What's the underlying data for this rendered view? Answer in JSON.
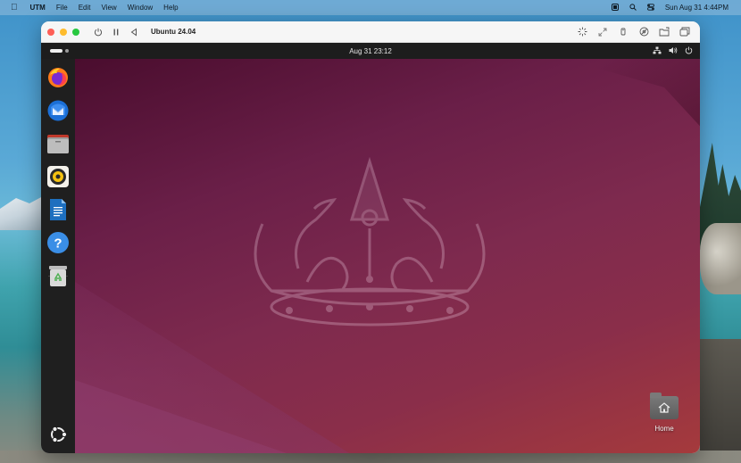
{
  "menubar": {
    "app_name": "UTM",
    "items": [
      "File",
      "Edit",
      "View",
      "Window",
      "Help"
    ],
    "datetime": "Sun Aug 31  4:44PM",
    "status_icons": [
      "screen-icon",
      "search-icon",
      "control-center-icon"
    ]
  },
  "window": {
    "title": "Ubuntu 24.04",
    "left_controls": [
      "power-icon",
      "pause-icon",
      "back-icon"
    ],
    "right_controls": [
      "display-icon",
      "resize-icon",
      "usb-icon",
      "drive-icon",
      "shared-folder-icon",
      "windows-icon"
    ]
  },
  "ubuntu": {
    "topbar": {
      "clock": "Aug 31  23:12",
      "tray_icons": [
        "network-icon",
        "volume-icon",
        "power-icon"
      ]
    },
    "dock": {
      "apps": [
        {
          "name": "Firefox",
          "icon": "firefox-icon"
        },
        {
          "name": "Thunderbird",
          "icon": "thunderbird-icon"
        },
        {
          "name": "Files",
          "icon": "files-icon"
        },
        {
          "name": "Rhythmbox",
          "icon": "rhythmbox-icon"
        },
        {
          "name": "LibreOffice Writer",
          "icon": "writer-icon"
        },
        {
          "name": "Help",
          "icon": "help-icon"
        },
        {
          "name": "Trash",
          "icon": "trash-icon"
        }
      ],
      "show_apps_icon": "ubuntu-logo-icon"
    },
    "desktop": {
      "home_label": "Home"
    }
  }
}
